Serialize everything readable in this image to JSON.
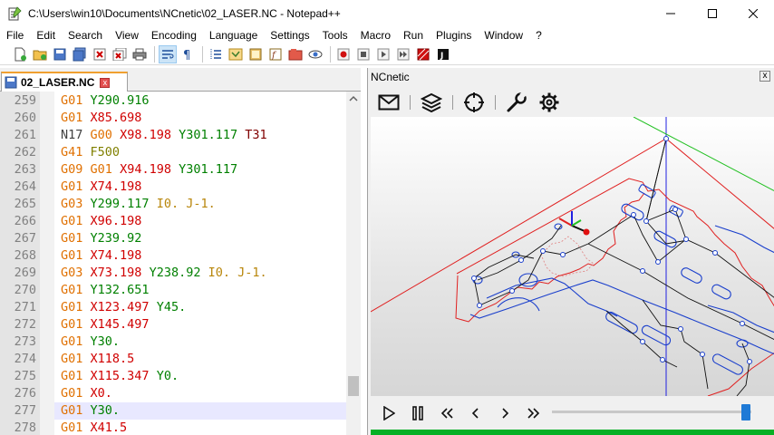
{
  "window": {
    "title": "C:\\Users\\win10\\Documents\\NCnetic\\02_LASER.NC - Notepad++",
    "minimize_label": "—",
    "maximize_label": "☐",
    "close_label": "✕"
  },
  "menu": [
    "File",
    "Edit",
    "Search",
    "View",
    "Encoding",
    "Language",
    "Settings",
    "Tools",
    "Macro",
    "Run",
    "Plugins",
    "Window",
    "?"
  ],
  "toolbar": {
    "icons": [
      "new-file",
      "open-file",
      "save",
      "save-all",
      "close",
      "close-all",
      "print",
      "cut",
      "copy",
      "paste",
      "undo",
      "redo",
      "find",
      "replace",
      "zoom-in",
      "zoom-out",
      "sync-v",
      "sync-h",
      "word-wrap",
      "show-all-chars",
      "indent-guide",
      "user-lang",
      "doc-map",
      "function-list",
      "folder-workspace",
      "monitoring",
      "record-macro",
      "stop-record",
      "play-macro",
      "play-multiple",
      "save-macro"
    ]
  },
  "editor": {
    "tab_label": "02_LASER.NC",
    "tab_close_label": "x",
    "current_line": 277,
    "lines": [
      {
        "num": "259",
        "tokens": [
          {
            "t": "G01",
            "c": "g"
          },
          {
            "t": " "
          },
          {
            "t": "Y290.916",
            "c": "y"
          }
        ]
      },
      {
        "num": "260",
        "tokens": [
          {
            "t": "G01",
            "c": "g"
          },
          {
            "t": " "
          },
          {
            "t": "X85.698",
            "c": "x"
          }
        ]
      },
      {
        "num": "261",
        "tokens": [
          {
            "t": "N17",
            "c": "n"
          },
          {
            "t": " "
          },
          {
            "t": "G00",
            "c": "g"
          },
          {
            "t": " "
          },
          {
            "t": "X98.198",
            "c": "x"
          },
          {
            "t": " "
          },
          {
            "t": "Y301.117",
            "c": "y"
          },
          {
            "t": " "
          },
          {
            "t": "T31",
            "c": "t"
          }
        ]
      },
      {
        "num": "262",
        "tokens": [
          {
            "t": "G41",
            "c": "g"
          },
          {
            "t": " "
          },
          {
            "t": "F500",
            "c": "f"
          }
        ]
      },
      {
        "num": "263",
        "tokens": [
          {
            "t": "G09",
            "c": "g"
          },
          {
            "t": " "
          },
          {
            "t": "G01",
            "c": "g"
          },
          {
            "t": " "
          },
          {
            "t": "X94.198",
            "c": "x"
          },
          {
            "t": " "
          },
          {
            "t": "Y301.117",
            "c": "y"
          }
        ]
      },
      {
        "num": "264",
        "tokens": [
          {
            "t": "G01",
            "c": "g"
          },
          {
            "t": " "
          },
          {
            "t": "X74.198",
            "c": "x"
          }
        ]
      },
      {
        "num": "265",
        "tokens": [
          {
            "t": "G03",
            "c": "g"
          },
          {
            "t": " "
          },
          {
            "t": "Y299.117",
            "c": "y"
          },
          {
            "t": " "
          },
          {
            "t": "I0.",
            "c": "io"
          },
          {
            "t": " "
          },
          {
            "t": "J-1.",
            "c": "io"
          }
        ]
      },
      {
        "num": "266",
        "tokens": [
          {
            "t": "G01",
            "c": "g"
          },
          {
            "t": " "
          },
          {
            "t": "X96.198",
            "c": "x"
          }
        ]
      },
      {
        "num": "267",
        "tokens": [
          {
            "t": "G01",
            "c": "g"
          },
          {
            "t": " "
          },
          {
            "t": "Y239.92",
            "c": "y"
          }
        ]
      },
      {
        "num": "268",
        "tokens": [
          {
            "t": "G01",
            "c": "g"
          },
          {
            "t": " "
          },
          {
            "t": "X74.198",
            "c": "x"
          }
        ]
      },
      {
        "num": "269",
        "tokens": [
          {
            "t": "G03",
            "c": "g"
          },
          {
            "t": " "
          },
          {
            "t": "X73.198",
            "c": "x"
          },
          {
            "t": " "
          },
          {
            "t": "Y238.92",
            "c": "y"
          },
          {
            "t": " "
          },
          {
            "t": "I0.",
            "c": "io"
          },
          {
            "t": " "
          },
          {
            "t": "J-1.",
            "c": "io"
          }
        ]
      },
      {
        "num": "270",
        "tokens": [
          {
            "t": "G01",
            "c": "g"
          },
          {
            "t": " "
          },
          {
            "t": "Y132.651",
            "c": "y"
          }
        ]
      },
      {
        "num": "271",
        "tokens": [
          {
            "t": "G01",
            "c": "g"
          },
          {
            "t": " "
          },
          {
            "t": "X123.497",
            "c": "x"
          },
          {
            "t": " "
          },
          {
            "t": "Y45.",
            "c": "y"
          }
        ]
      },
      {
        "num": "272",
        "tokens": [
          {
            "t": "G01",
            "c": "g"
          },
          {
            "t": " "
          },
          {
            "t": "X145.497",
            "c": "x"
          }
        ]
      },
      {
        "num": "273",
        "tokens": [
          {
            "t": "G01",
            "c": "g"
          },
          {
            "t": " "
          },
          {
            "t": "Y30.",
            "c": "y"
          }
        ]
      },
      {
        "num": "274",
        "tokens": [
          {
            "t": "G01",
            "c": "g"
          },
          {
            "t": " "
          },
          {
            "t": "X118.5",
            "c": "x"
          }
        ]
      },
      {
        "num": "275",
        "tokens": [
          {
            "t": "G01",
            "c": "g"
          },
          {
            "t": " "
          },
          {
            "t": "X115.347",
            "c": "x"
          },
          {
            "t": " "
          },
          {
            "t": "Y0.",
            "c": "y"
          }
        ]
      },
      {
        "num": "276",
        "tokens": [
          {
            "t": "G01",
            "c": "g"
          },
          {
            "t": " "
          },
          {
            "t": "X0.",
            "c": "x"
          }
        ]
      },
      {
        "num": "277",
        "tokens": [
          {
            "t": "G01",
            "c": "g"
          },
          {
            "t": " "
          },
          {
            "t": "Y30.",
            "c": "y"
          }
        ]
      },
      {
        "num": "278",
        "tokens": [
          {
            "t": "G01",
            "c": "g"
          },
          {
            "t": " "
          },
          {
            "t": "X41.5",
            "c": "x"
          }
        ]
      }
    ],
    "scroll_position": 0.87
  },
  "ncnetic": {
    "title": "NCnetic",
    "close_label": "x",
    "toolbar_icons": [
      "mail-icon",
      "layers-icon",
      "crosshair-icon",
      "wrench-icon",
      "gear-icon"
    ],
    "controls": [
      "play",
      "pause",
      "rewind-fast",
      "step-back",
      "step-forward",
      "forward-fast"
    ],
    "playback_progress": 0.97,
    "colors": {
      "toolpath": "#1a3fcc",
      "sheet_outline": "#e02020",
      "rapid": "#101010",
      "axis_x": "#e02020",
      "axis_y": "#20c020",
      "axis_z": "#2020e0",
      "status": "#06b025"
    }
  }
}
